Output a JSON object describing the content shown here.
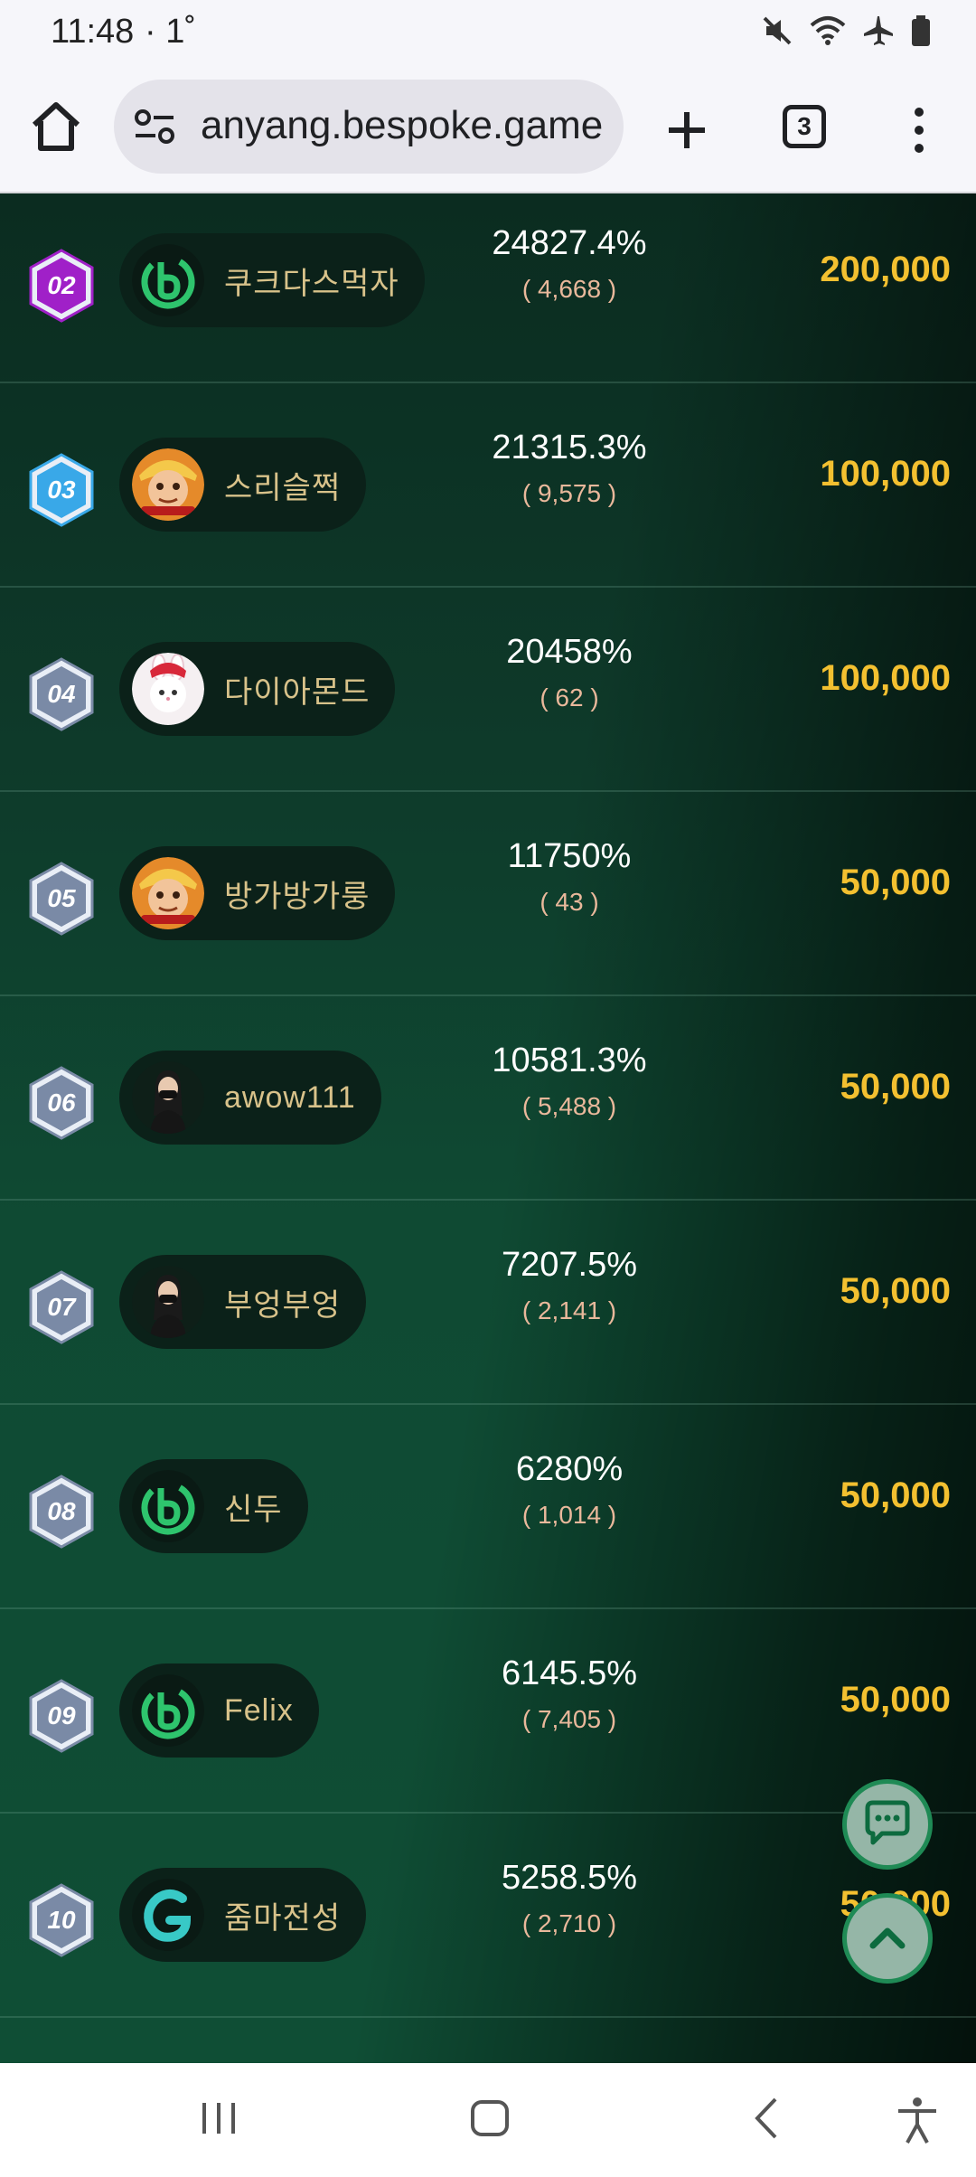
{
  "status_bar": {
    "time": "11:48",
    "extra": "· 1˚"
  },
  "browser": {
    "url": "anyang.bespoke.game",
    "tab_count": "3"
  },
  "ranking": [
    {
      "rank": "02",
      "badge_color": "#a020c8",
      "nickname": "쿠크다스먹자",
      "avatar": "brand-b",
      "percent": "24827.4%",
      "count": "( 4,668 )",
      "prize": "200,000"
    },
    {
      "rank": "03",
      "badge_color": "#39a8e8",
      "nickname": "스리슬쩍",
      "avatar": "monkey",
      "percent": "21315.3%",
      "count": "( 9,575 )",
      "prize": "100,000"
    },
    {
      "rank": "04",
      "badge_color": "#7a8aa6",
      "nickname": "다이아몬드",
      "avatar": "rabbit",
      "percent": "20458%",
      "count": "( 62 )",
      "prize": "100,000"
    },
    {
      "rank": "05",
      "badge_color": "#7a8aa6",
      "nickname": "방가방가룽",
      "avatar": "monkey",
      "percent": "11750%",
      "count": "( 43 )",
      "prize": "50,000"
    },
    {
      "rank": "06",
      "badge_color": "#7a8aa6",
      "nickname": "awow111",
      "avatar": "person",
      "percent": "10581.3%",
      "count": "( 5,488 )",
      "prize": "50,000"
    },
    {
      "rank": "07",
      "badge_color": "#7a8aa6",
      "nickname": "부엉부엉",
      "avatar": "person",
      "percent": "7207.5%",
      "count": "( 2,141 )",
      "prize": "50,000"
    },
    {
      "rank": "08",
      "badge_color": "#7a8aa6",
      "nickname": "신두",
      "avatar": "brand-b",
      "percent": "6280%",
      "count": "( 1,014 )",
      "prize": "50,000"
    },
    {
      "rank": "09",
      "badge_color": "#7a8aa6",
      "nickname": "Felix",
      "avatar": "brand-b",
      "percent": "6145.5%",
      "count": "( 7,405 )",
      "prize": "50,000"
    },
    {
      "rank": "10",
      "badge_color": "#7a8aa6",
      "nickname": "줌마전성",
      "avatar": "brand-g",
      "percent": "5258.5%",
      "count": "( 2,710 )",
      "prize": "50,000"
    }
  ],
  "colors": {
    "prize": "#f3c030",
    "nickname": "#d8c28a",
    "count": "#e9b89b"
  },
  "icons": [
    "home-icon",
    "site-settings-icon",
    "new-tab-icon",
    "tab-switcher-icon",
    "more-menu-icon",
    "chat-icon",
    "scroll-top-icon",
    "recent-apps-icon",
    "home-nav-icon",
    "back-icon",
    "accessibility-icon"
  ]
}
